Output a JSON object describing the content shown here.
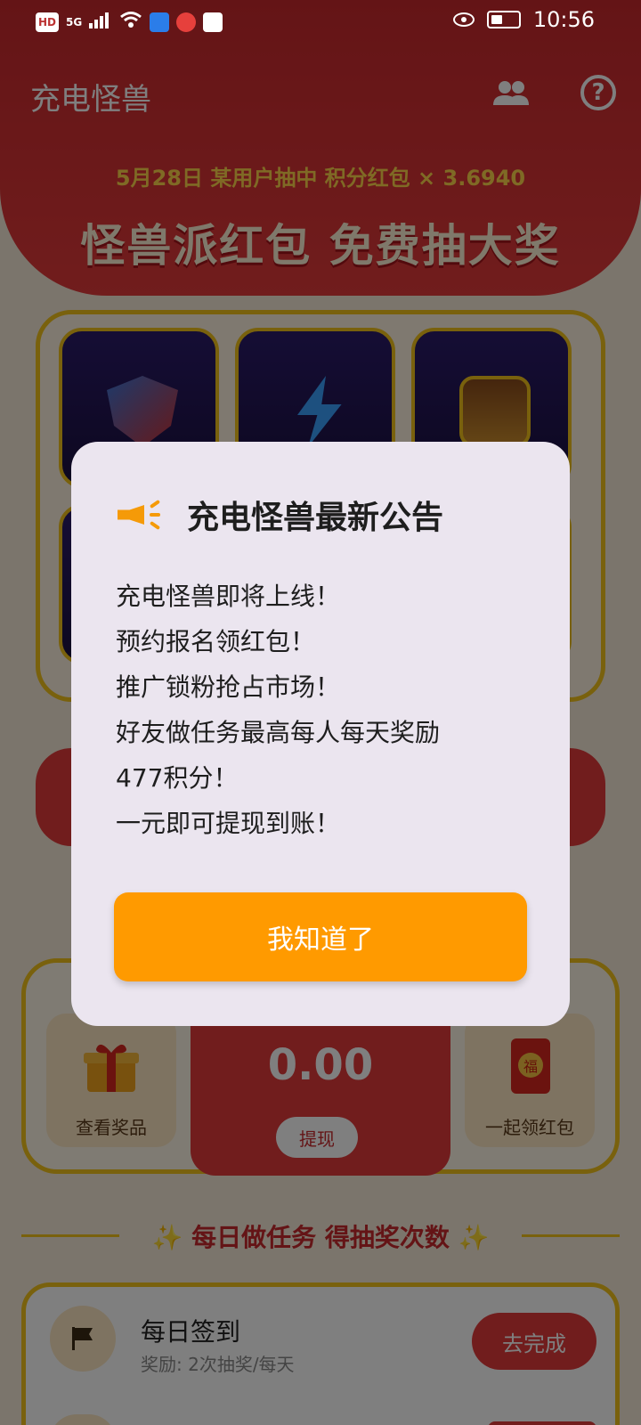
{
  "status_bar": {
    "left_labels": [
      "HD",
      "5G"
    ],
    "time": "10:56"
  },
  "header": {
    "app_title": "充电怪兽",
    "ticker": "5月28日 某用户抽中 积分红包 × 3.6940",
    "banner_title": "怪兽派红包 免费抽大奖"
  },
  "wallet": {
    "left_card_label": "查看奖品",
    "balance": "0.00",
    "withdraw_label": "提现",
    "right_card_label": "一起领红包"
  },
  "tasks": {
    "section_title": "✨ 每日做任务 得抽奖次数 ✨",
    "items": [
      {
        "name": "每日签到",
        "desc": "奖励: 2次抽奖/每天",
        "button": "去完成"
      }
    ]
  },
  "dialog": {
    "title": "充电怪兽最新公告",
    "lines": [
      "充电怪兽即将上线！",
      "预约报名领红包！",
      "推广锁粉抢占市场！",
      "好友做任务最高每人每天奖励",
      "477积分！",
      "一元即可提现到账！"
    ],
    "confirm_label": "我知道了"
  },
  "colors": {
    "brand_red": "#e23a3a",
    "gold": "#f2c21a",
    "dialog_button": "#ff9a00"
  }
}
